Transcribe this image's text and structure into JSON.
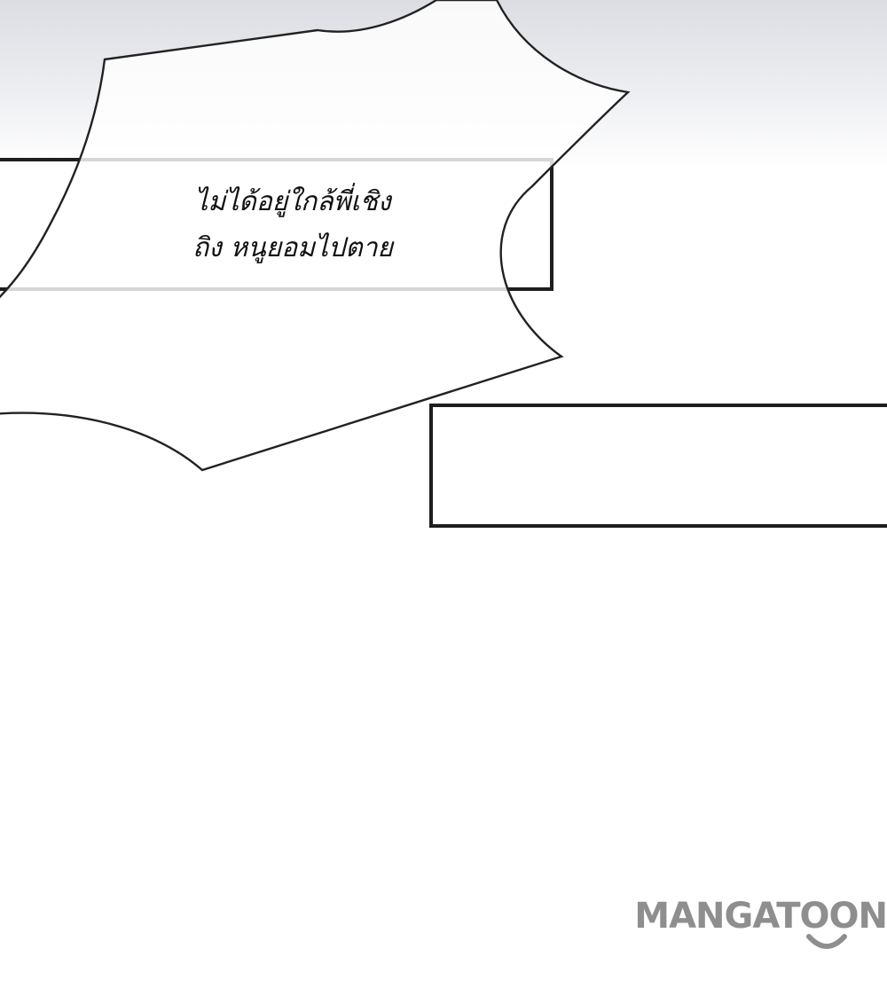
{
  "speech_bubble": {
    "lines": [
      "ไม่ได้อยู่ใกล้พี่เชิง",
      "ถิง หนูยอมไปตาย"
    ]
  },
  "watermark": {
    "text": "MANGATOON"
  },
  "colors": {
    "ink": "#1e1e1e",
    "top_shade": "#dcdde2",
    "watermark": "#8e8e8e",
    "background": "#ffffff"
  }
}
